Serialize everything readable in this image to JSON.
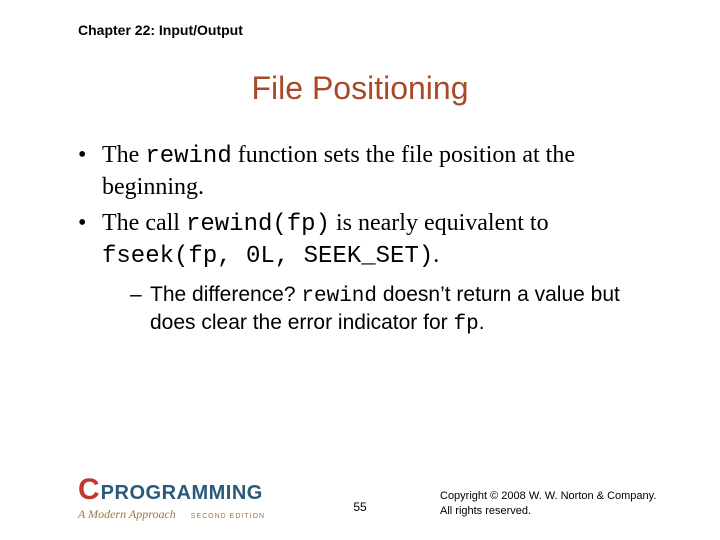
{
  "chapter": "Chapter 22: Input/Output",
  "title": "File Positioning",
  "bullets": {
    "b1_pre": "The ",
    "b1_code": "rewind",
    "b1_post": " function sets the file position at the beginning.",
    "b2_pre": "The call ",
    "b2_code1": "rewind(fp)",
    "b2_mid": " is nearly equivalent to ",
    "b2_code2": "fseek(fp, 0L, SEEK_SET)",
    "b2_post": ".",
    "sub_pre": "The difference? ",
    "sub_code1": "rewind",
    "sub_mid": " doesn’t return a value but does clear the error indicator for ",
    "sub_code2": "fp",
    "sub_post": "."
  },
  "logo": {
    "c": "C",
    "prog": "PROGRAMMING",
    "tagline": "A Modern Approach",
    "edition": "SECOND EDITION"
  },
  "page": "55",
  "copyright": {
    "line1": "Copyright © 2008 W. W. Norton & Company.",
    "line2": "All rights reserved."
  }
}
